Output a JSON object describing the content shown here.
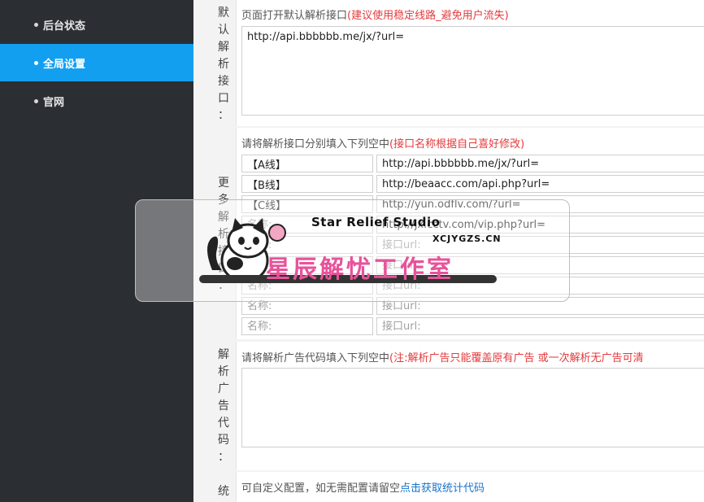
{
  "sidebar": {
    "items": [
      {
        "label": "后台状态",
        "active": false
      },
      {
        "label": "全局设置",
        "active": true
      },
      {
        "label": "官网",
        "active": false
      }
    ]
  },
  "default_api": {
    "label_chars": [
      "默",
      "认",
      "解",
      "析",
      "接",
      "口",
      "："
    ],
    "hint": "页面打开默认解析接口",
    "hint_red": "(建议使用稳定线路_避免用户流失)",
    "value": "http://api.bbbbbb.me/jx/?url="
  },
  "more_api": {
    "label_chars": [
      "更",
      "多",
      "解",
      "析",
      "接",
      "口",
      "："
    ],
    "hint": "请将解析接口分别填入下列空中",
    "hint_red": "(接口名称根据自己喜好修改)",
    "name_placeholder": "名称:",
    "url_placeholder": "接口url:",
    "lines": [
      {
        "name": "【A线】",
        "url": "http://api.bbbbbb.me/jx/?url="
      },
      {
        "name": "【B线】",
        "url": "http://beaacc.com/api.php?url="
      },
      {
        "name": "【C线】",
        "url": "http://yun.odflv.com/?url="
      },
      {
        "name": "",
        "url": "http://jx.cctv.com/vip.php?url="
      },
      {
        "name": "",
        "url": ""
      },
      {
        "name": "",
        "url": ""
      },
      {
        "name": "",
        "url": ""
      },
      {
        "name": "",
        "url": ""
      },
      {
        "name": "",
        "url": ""
      }
    ]
  },
  "ad_code": {
    "label_chars": [
      "解",
      "析",
      "广",
      "告",
      "代",
      "码",
      "："
    ],
    "hint": "请将解析广告代码填入下列空中",
    "hint_red": "(注:解析广告只能覆盖原有广告 或一次解析无广告可清"
  },
  "stats": {
    "label_chars": [
      "统"
    ],
    "hint": "可自定义配置，如无需配置请留空",
    "link": "点击获取统计代码"
  },
  "watermark": {
    "en": "Star Relief Studio",
    "url": "XCJYGZS.CN",
    "cn": "星辰解忧工作室"
  }
}
